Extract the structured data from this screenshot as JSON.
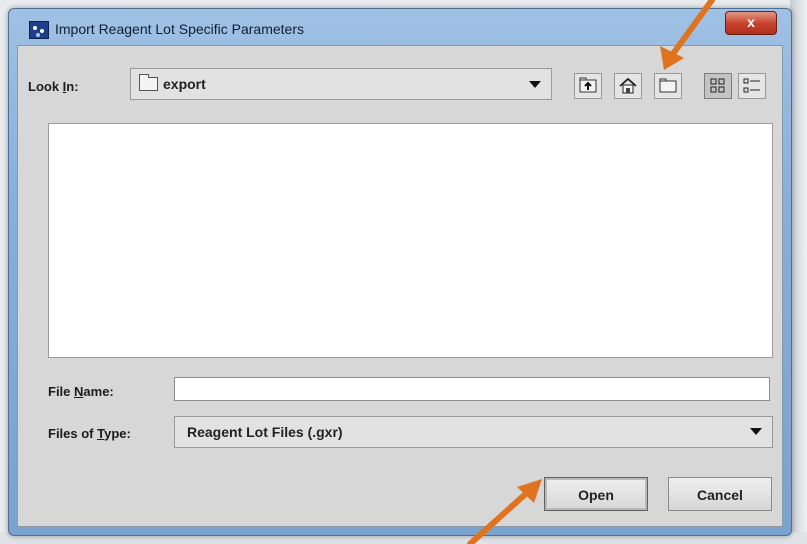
{
  "window": {
    "title": "Import Reagent Lot Specific Parameters",
    "close_label": "x"
  },
  "look_in": {
    "label_prefix": "Look ",
    "label_mnemonic": "I",
    "label_suffix": "n:",
    "value": "export"
  },
  "toolbar": {
    "buttons": [
      "up-one-level",
      "home",
      "create-new-folder",
      "list-view",
      "details-view"
    ],
    "active": "list-view"
  },
  "file_list": {
    "items": []
  },
  "file_name": {
    "label_prefix": "File ",
    "label_mnemonic": "N",
    "label_suffix": "ame:",
    "value": ""
  },
  "files_of_type": {
    "label_prefix": "Files of ",
    "label_mnemonic": "T",
    "label_suffix": "ype:",
    "value": "Reagent Lot Files (.gxr)"
  },
  "actions": {
    "open_label": "Open",
    "cancel_label": "Cancel"
  },
  "annotations": {
    "arrow_color": "#e0731f"
  },
  "colors": {
    "title_bar": "#8fb5de",
    "close_button": "#c8442d",
    "dialog_body": "#d7d7d7"
  }
}
